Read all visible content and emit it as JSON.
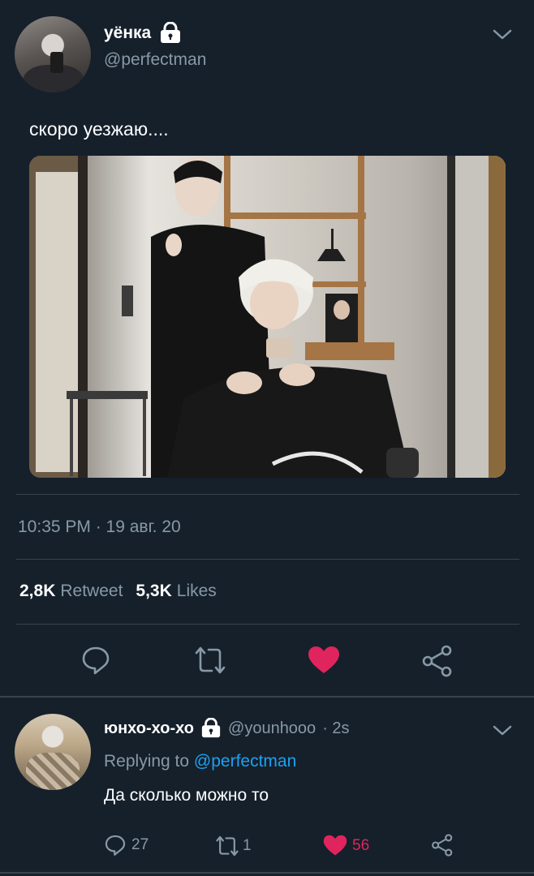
{
  "tweet": {
    "display_name": "уёнка",
    "handle": "@perfectman",
    "text": "скоро уезжаю....",
    "timestamp": "10:35 PM · 19 авг. 20",
    "retweet_count": "2,8K",
    "retweet_label": "Retweet",
    "likes_count": "5,3K",
    "likes_label": "Likes",
    "liked": true
  },
  "reply": {
    "display_name": "юнхо-хо-хо",
    "handle": "@younhooo",
    "time": "· 2s",
    "replying_prefix": "Replying to",
    "replying_to": "@perfectman",
    "text": "Да сколько можно то",
    "reply_count": "27",
    "retweet_count": "1",
    "like_count": "56"
  },
  "colors": {
    "background": "#15202b",
    "secondary_text": "#8899a6",
    "link": "#1da1f2",
    "like": "#e0245e",
    "divider": "#38444d"
  },
  "icons": [
    "lock-icon",
    "chevron-down-icon",
    "reply-icon",
    "retweet-icon",
    "heart-icon",
    "share-icon"
  ]
}
